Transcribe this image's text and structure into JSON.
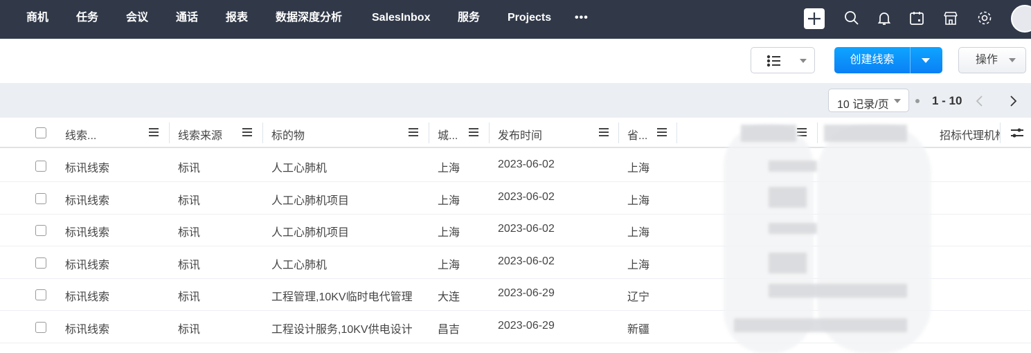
{
  "nav": {
    "items": [
      "商机",
      "任务",
      "会议",
      "通话",
      "报表",
      "数据深度分析",
      "SalesInbox",
      "服务",
      "Projects"
    ],
    "more_icon": "more-dots-icon"
  },
  "top_icons": [
    "plus-icon",
    "search-icon",
    "bell-icon",
    "calendar-icon",
    "store-icon",
    "gear-icon",
    "avatar"
  ],
  "toolbar": {
    "view_icon": "list-view-icon",
    "create_label": "创建线索",
    "actions_label": "操作"
  },
  "pagination": {
    "per_page": "10 记录/页",
    "range": "1 - 10"
  },
  "table": {
    "headers": [
      "线索...",
      "线索来源",
      "标的物",
      "城...",
      "发布时间",
      "省...",
      "",
      "",
      "招标代理机构"
    ],
    "rows": [
      [
        "标讯线索",
        "标讯",
        "人工心肺机",
        "上海",
        "2023-06-02",
        "上海"
      ],
      [
        "标讯线索",
        "标讯",
        "人工心肺机项目",
        "上海",
        "2023-06-02",
        "上海"
      ],
      [
        "标讯线索",
        "标讯",
        "人工心肺机项目",
        "上海",
        "2023-06-02",
        "上海"
      ],
      [
        "标讯线索",
        "标讯",
        "人工心肺机",
        "上海",
        "2023-06-02",
        "上海"
      ],
      [
        "标讯线索",
        "标讯",
        "工程管理,10KV临时电代管理",
        "大连",
        "2023-06-29",
        "辽宁"
      ],
      [
        "标讯线索",
        "标讯",
        "工程设计服务,10KV供电设计",
        "昌吉",
        "2023-06-29",
        "新疆"
      ]
    ]
  },
  "colors": {
    "topbar": "#313949",
    "primary": "#0a84ff",
    "background": "#ebeef3"
  }
}
